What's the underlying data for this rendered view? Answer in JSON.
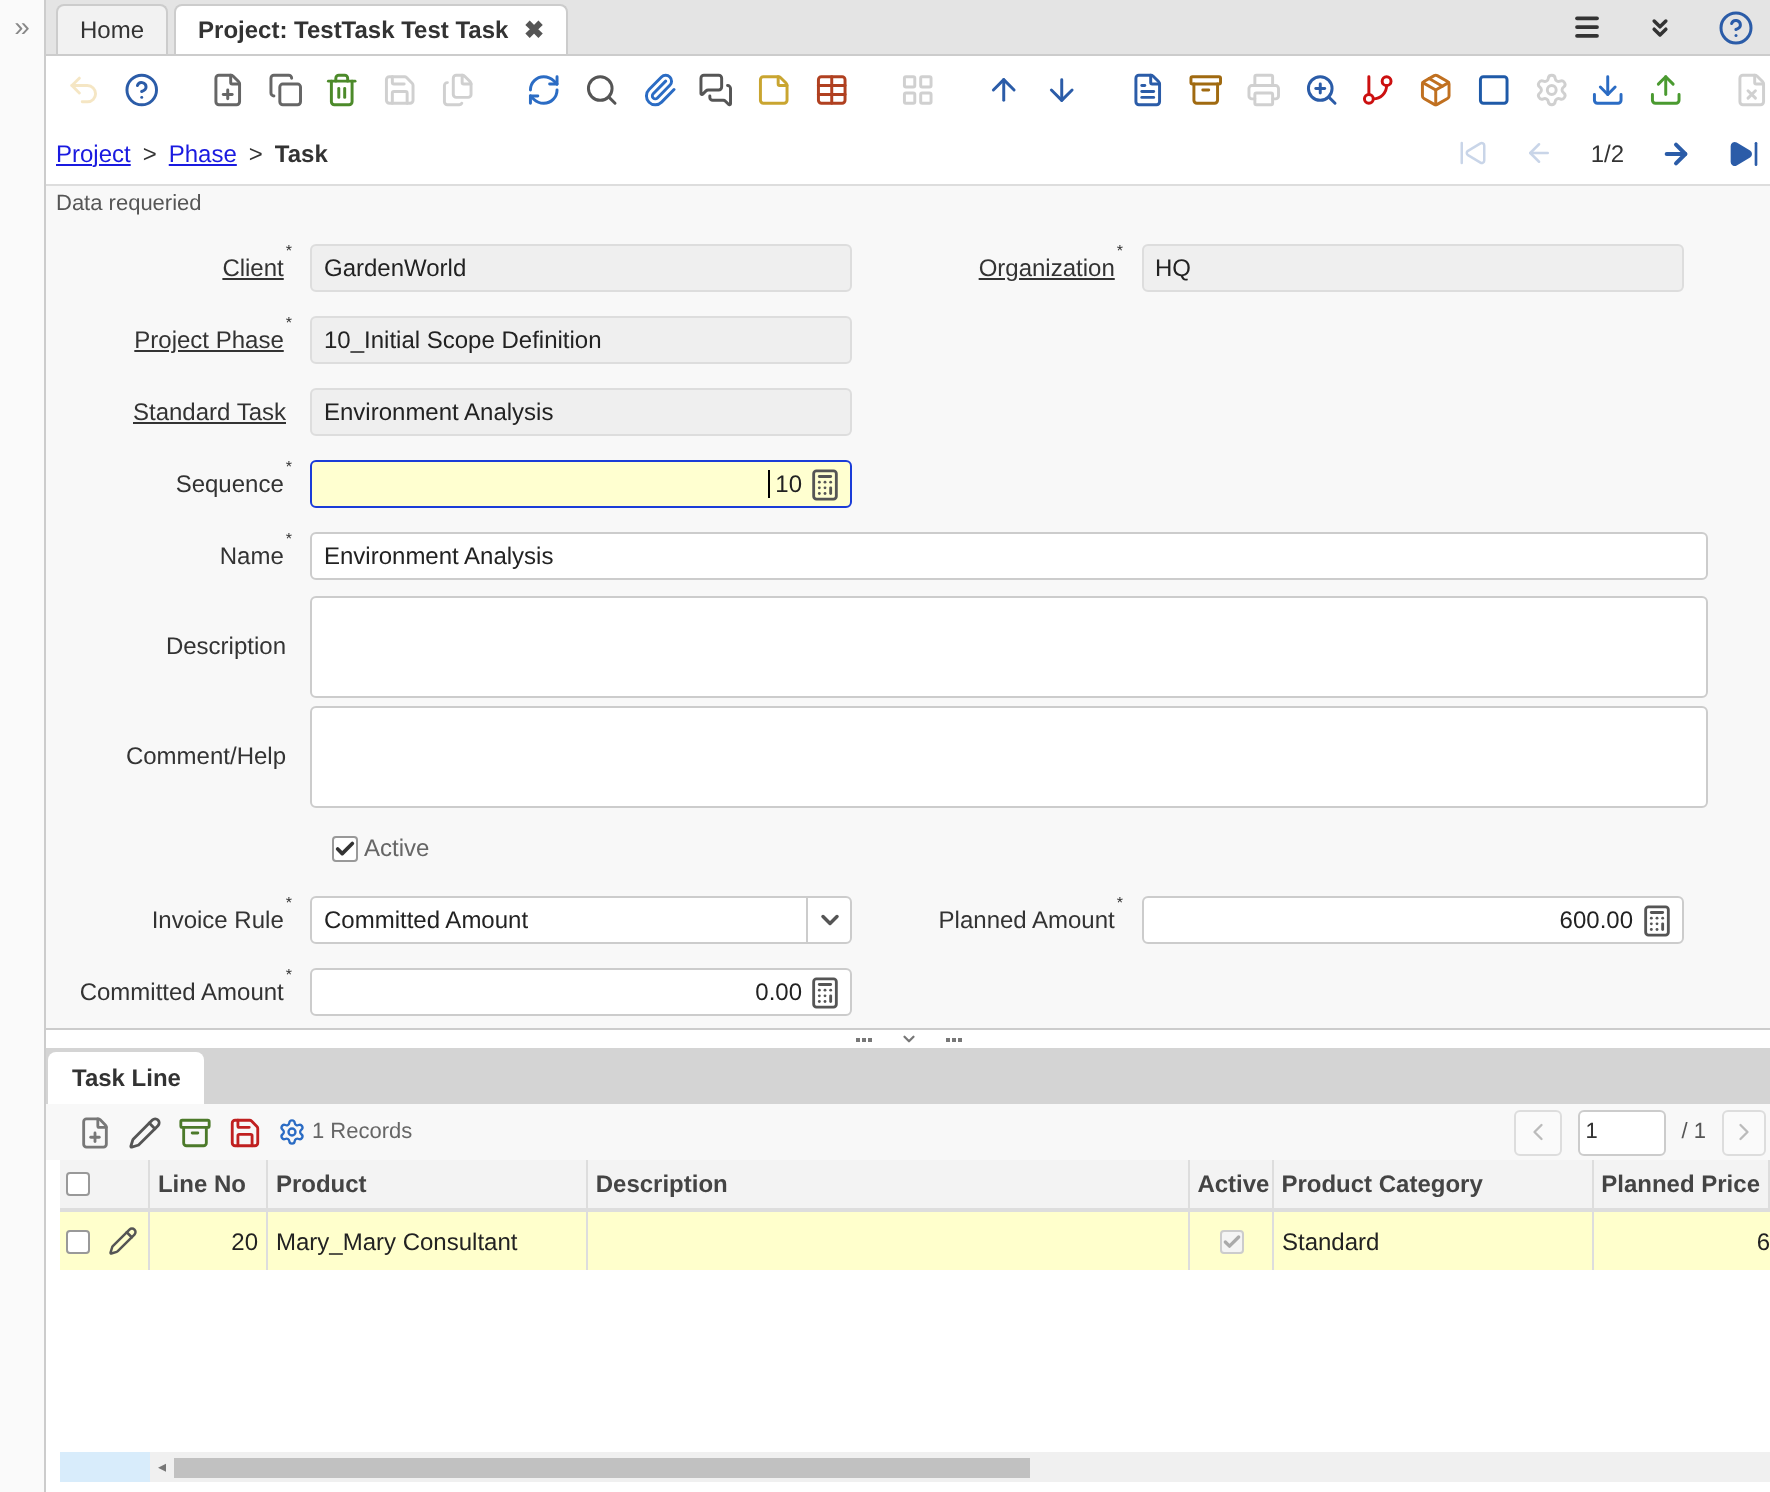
{
  "side_toggle": "»",
  "tabs": [
    {
      "label": "Home",
      "selected": false,
      "closable": false
    },
    {
      "label": "Project: TestTask Test Task",
      "selected": true,
      "closable": true
    }
  ],
  "close_glyph": "✖",
  "toolbar": [
    {
      "disabled": true
    },
    {
      "disabled": false
    },
    {
      "disabled": false
    },
    {
      "disabled": false
    },
    {
      "disabled": false
    },
    {
      "disabled": true
    },
    {
      "disabled": true
    },
    {
      "disabled": false
    },
    {
      "disabled": false
    },
    {
      "disabled": false
    },
    {
      "disabled": false
    },
    {
      "disabled": false
    },
    {
      "disabled": false
    },
    {
      "disabled": true
    },
    {
      "disabled": false
    },
    {
      "disabled": false
    },
    {
      "disabled": false
    },
    {
      "disabled": false
    },
    {
      "disabled": true
    },
    {
      "disabled": false
    },
    {
      "disabled": false
    },
    {
      "disabled": false
    },
    {
      "disabled": false
    },
    {
      "disabled": true
    },
    {
      "disabled": false
    },
    {
      "disabled": false
    },
    {
      "disabled": true
    }
  ],
  "breadcrumb": {
    "links": [
      "Project",
      "Phase"
    ],
    "separator": ">",
    "current": "Task"
  },
  "record_nav": {
    "position": "1/2",
    "first_disabled": true,
    "prev_disabled": true,
    "next_disabled": false,
    "last_disabled": false
  },
  "status": "Data requeried",
  "required_mark": "*",
  "form": [
    [
      {
        "kind": "readonly",
        "label": "Client",
        "link": true,
        "required": true,
        "value": "GardenWorld"
      },
      {
        "kind": "readonly",
        "label": "Organization",
        "link": true,
        "required": true,
        "value": "HQ"
      }
    ],
    [
      {
        "kind": "readonly",
        "label": "Project Phase",
        "link": true,
        "required": true,
        "value": "10_Initial Scope Definition"
      }
    ],
    [
      {
        "kind": "readonly",
        "label": "Standard Task",
        "link": true,
        "required": false,
        "value": "Environment Analysis"
      }
    ],
    [
      {
        "kind": "number",
        "label": "Sequence",
        "link": false,
        "required": true,
        "value": "10",
        "focused": true
      }
    ],
    [
      {
        "kind": "text",
        "label": "Name",
        "link": false,
        "required": true,
        "value": "Environment Analysis"
      }
    ],
    [
      {
        "kind": "textarea",
        "label": "Description",
        "link": false,
        "required": false
      }
    ],
    [
      {
        "kind": "textarea",
        "label": "Comment/Help",
        "link": false,
        "required": false
      }
    ],
    [
      {
        "kind": "checkbox",
        "label": "Active",
        "checked": true
      }
    ],
    [
      {
        "kind": "select",
        "label": "Invoice Rule",
        "link": false,
        "required": true,
        "value": "Committed Amount"
      },
      {
        "kind": "number",
        "label": "Planned Amount",
        "link": false,
        "required": true,
        "value": "600.00",
        "focused": false
      }
    ],
    [
      {
        "kind": "number",
        "label": "Committed Amount",
        "link": false,
        "required": true,
        "value": "0.00",
        "focused": false
      }
    ]
  ],
  "detail": {
    "tab": "Task Line",
    "all_selected": false,
    "scroll_left": "◂",
    "records": "1 Records",
    "page": "1",
    "page_total": "/ 1",
    "columns": [
      "Line No",
      "Product",
      "Description",
      "Active",
      "Product Category",
      "Planned Price"
    ],
    "rows": [
      {
        "selected": false,
        "line_no": "20",
        "product": "Mary_Mary Consultant",
        "description": "",
        "active": true,
        "product_category": "Standard",
        "planned_price": "6"
      }
    ]
  }
}
